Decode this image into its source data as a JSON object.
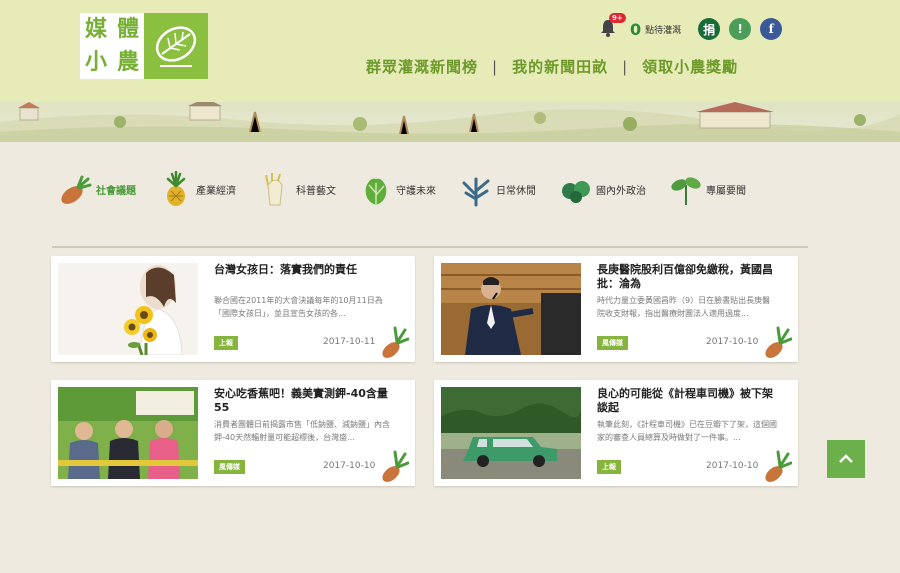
{
  "header": {
    "logo_chars": [
      "媒",
      "體",
      "小",
      "農"
    ],
    "notifications_badge": "9+",
    "points_value": "0",
    "points_label": "點待灌溉",
    "donate_label": "捐",
    "info_label": "!",
    "fb_label": "f",
    "nav": [
      "群眾灌溉新聞榜",
      "我的新聞田畝",
      "領取小農獎勵"
    ],
    "nav_separator": "|"
  },
  "categories": [
    {
      "label": "社會議題",
      "icon": "sweet-potato-icon",
      "active": true
    },
    {
      "label": "產業經濟",
      "icon": "pineapple-icon",
      "active": false
    },
    {
      "label": "科普藝文",
      "icon": "bamboo-shoot-icon",
      "active": false
    },
    {
      "label": "守護未來",
      "icon": "cabbage-icon",
      "active": false
    },
    {
      "label": "日常休閒",
      "icon": "herb-icon",
      "active": false
    },
    {
      "label": "國內外政治",
      "icon": "vegetable-icon",
      "active": false
    },
    {
      "label": "專屬要聞",
      "icon": "sprout-icon",
      "active": false
    }
  ],
  "articles": [
    {
      "title": "台灣女孩日：落實我們的責任",
      "excerpt": "聯合國在2011年的大會決議每年的10月11日為「國際女孩日」，並且宣告女孩的各...",
      "source": "上報",
      "date": "2017-10-11",
      "thumb": "girl-with-sunflowers-icon"
    },
    {
      "title": "長庚醫院股利百億卻免繳稅，黃國昌批：淪為",
      "excerpt": "時代力量立委黃國昌昨（9）日在臉書貼出長庚醫院收支財報，指出醫療財團法人適用過度...",
      "source": "風傳媒",
      "date": "2017-10-10",
      "thumb": "speaker-at-podium-icon"
    },
    {
      "title": "安心吃香蕉吧！義美實測鉀-40含量 55",
      "excerpt": "消費者團體日前揭露市售「低鈉鹽、減鈉鹽」內含鉀-40天然輻射量可能超標後，台灣盛...",
      "source": "風傳媒",
      "date": "2017-10-10",
      "thumb": "press-conference-icon"
    },
    {
      "title": "良心的可能從《計程車司機》被下架談起",
      "excerpt": "執筆此刻，《計程車司機》已在豆瓣下了架，這個國家的審查人員總算及時做對了一件事。...",
      "source": "上報",
      "date": "2017-10-10",
      "thumb": "green-taxi-icon"
    }
  ],
  "colors": {
    "accent": "#86b43c",
    "header_bg": "#e6ebb8",
    "page_bg": "#efeadf"
  }
}
